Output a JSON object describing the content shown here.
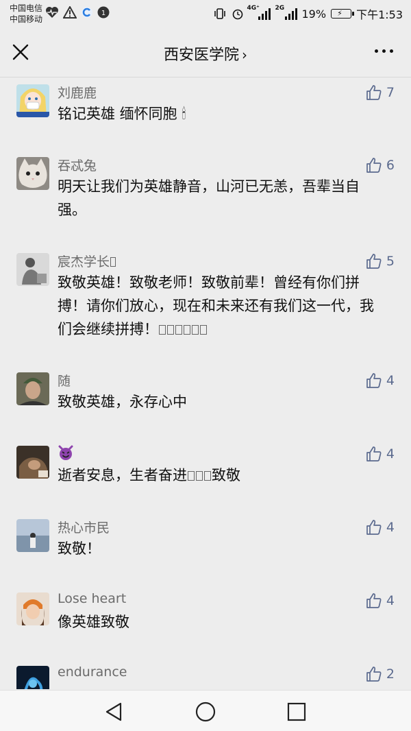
{
  "status_bar": {
    "carrier1": "中国电信",
    "carrier2": "中国移动",
    "net1": "4G⁺",
    "net2": "2G",
    "battery": "19%",
    "time": "下午1:53"
  },
  "header": {
    "title": "西安医学院",
    "chevron": "›"
  },
  "comments": [
    {
      "name": "刘鹿鹿",
      "text": "铭记英雄 缅怀同胞 🕯",
      "likes": "7"
    },
    {
      "name": "吞忒兔",
      "text": "明天让我们为英雄静音，山河已无恙，吾辈当自强。",
      "likes": "6"
    },
    {
      "name": "宸杰学长",
      "text": "致敬英雄！致敬老师！致敬前辈！曾经有你们拼搏！请你们放心，现在和未来还有我们这一代，我们会继续拼搏！",
      "likes": "5"
    },
    {
      "name": "随",
      "text": "致敬英雄，永存心中",
      "likes": "4"
    },
    {
      "name": "😈",
      "text": "逝者安息，生者奋进",
      "text_after": "致敬",
      "likes": "4"
    },
    {
      "name": "热心市民",
      "text": "致敬！",
      "likes": "4"
    },
    {
      "name": "Lose heart",
      "text": "像英雄致敬",
      "likes": "4"
    },
    {
      "name": "endurance",
      "text": "",
      "likes": "2"
    }
  ],
  "colors": {
    "background": "#ededed",
    "name": "#6b6b6b",
    "like_accent": "#5b6a8e"
  },
  "icons": [
    "close-icon",
    "more-icon",
    "thumbs-up-icon",
    "back-triangle-icon",
    "home-circle-icon",
    "recents-square-icon"
  ]
}
